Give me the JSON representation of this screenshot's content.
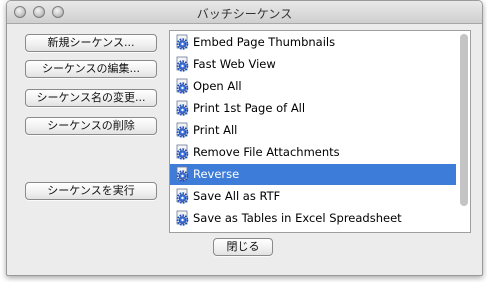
{
  "window": {
    "title": "バッチシーケンス"
  },
  "buttons": {
    "new_sequence": "新規シーケンス...",
    "edit_sequence": "シーケンスの編集...",
    "rename_sequence": "シーケンス名の変更...",
    "delete_sequence": "シーケンスの削除",
    "run_sequence": "シーケンスを実行",
    "close": "閉じる"
  },
  "sequences": [
    "Embed Page Thumbnails",
    "Fast Web View",
    "Open All",
    "Print 1st Page of All",
    "Print All",
    "Remove File Attachments",
    "Reverse",
    "Save All as RTF",
    "Save as Tables in Excel Spreadsheet"
  ],
  "selected_sequence": "Reverse",
  "icon": "gear-document-icon",
  "colors": {
    "selection": "#3d7dd9"
  }
}
